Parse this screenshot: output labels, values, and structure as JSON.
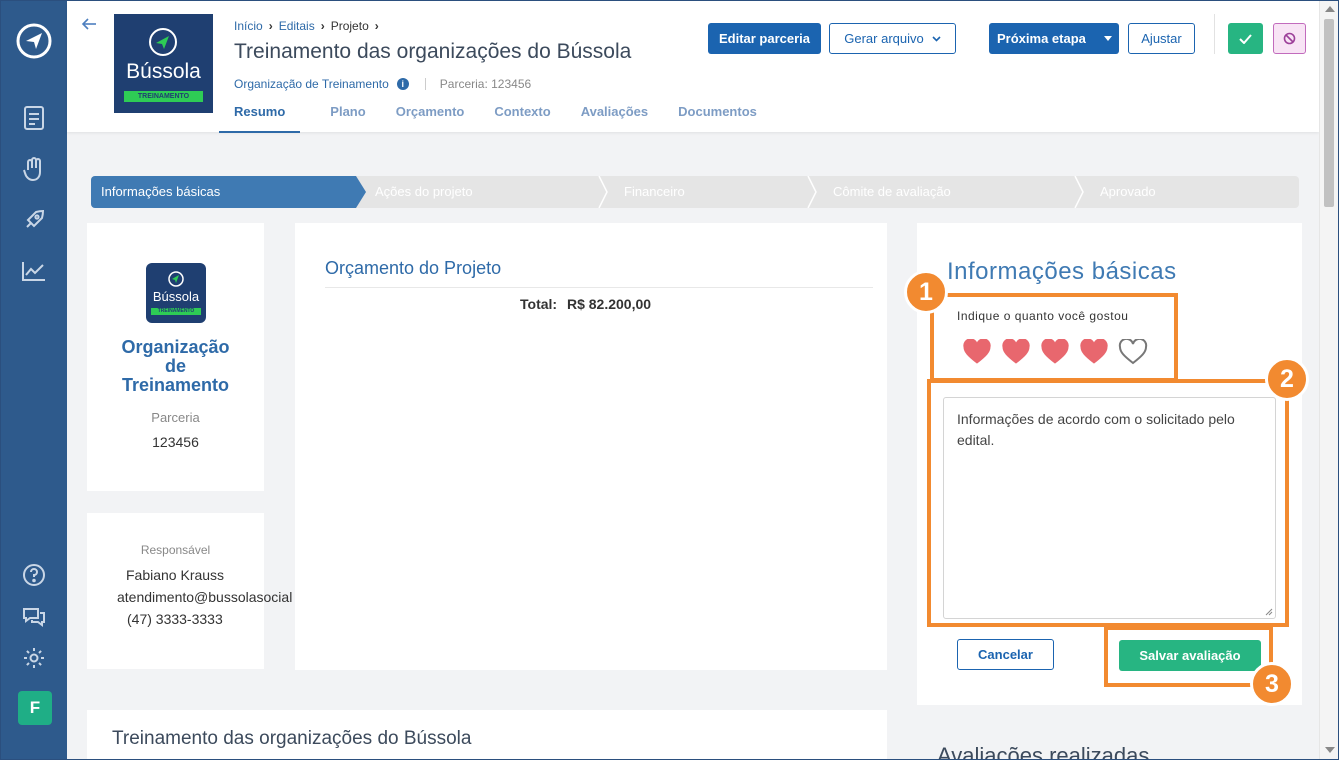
{
  "sidebar": {
    "icons": [
      "compass-logo-icon",
      "document-icon",
      "hand-heart-icon",
      "rocket-icon",
      "chart-icon",
      "help-icon",
      "chat-icon",
      "gear-icon"
    ],
    "avatar_letter": "F"
  },
  "header": {
    "logo_text": "Bússola",
    "logo_subtext": "TREINAMENTO",
    "breadcrumb": [
      "Início",
      "Editais",
      "Projeto"
    ],
    "title": "Treinamento das organizações do Bússola",
    "org_link": "Organização de Treinamento",
    "parceria": "Parceria: 123456",
    "tabs": [
      "Resumo",
      "Plano",
      "Orçamento",
      "Contexto",
      "Avaliações",
      "Documentos"
    ],
    "buttons": {
      "edit": "Editar parceria",
      "generate": "Gerar arquivo",
      "next": "Próxima etapa",
      "adjust": "Ajustar"
    }
  },
  "stepper": [
    "Informações básicas",
    "Ações do projeto",
    "Financeiro",
    "Cômite de avaliação",
    "Aprovado"
  ],
  "org_card": {
    "logo_text": "Bússola",
    "logo_subtext": "TREINAMENTO",
    "name_lines": [
      "Organização",
      "de",
      "Treinamento"
    ],
    "parceria_label": "Parceria",
    "parceria_value": "123456"
  },
  "resp_card": {
    "label": "Responsável",
    "name": "Fabiano Krauss",
    "email": "atendimento@bussolasocial",
    "phone": "(47) 3333-3333"
  },
  "budget": {
    "title": "Orçamento do Projeto",
    "total_label": "Total:",
    "total_value": "R$ 82.200,00"
  },
  "evaluation": {
    "title": "Informações básicas",
    "rating_label": "Indique o quanto você gostou",
    "rating": 4,
    "rating_max": 5,
    "comment": "Informações de acordo com o solicitado pelo edital.",
    "cancel": "Cancelar",
    "save": "Salvar avaliação"
  },
  "bottom": {
    "project_title": "Treinamento das organizações do Bússola",
    "evaluations_title": "Avaliações realizadas"
  },
  "annotations": [
    "1",
    "2",
    "3"
  ],
  "colors": {
    "sidebar": "#2e5a8c",
    "primary": "#1b64b0",
    "green": "#27b582",
    "annotation": "#f28a30",
    "heart": "#e8676e"
  }
}
